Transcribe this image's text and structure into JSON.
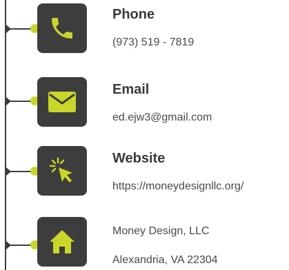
{
  "accent_color": "#c9d62a",
  "dark_color": "#3d3d3d",
  "contacts": [
    {
      "icon": "phone-icon",
      "title": "Phone",
      "detail": "(973) 519 - 7819"
    },
    {
      "icon": "envelope-icon",
      "title": "Email",
      "detail": "ed.ejw3@gmail.com"
    },
    {
      "icon": "cursor-click-icon",
      "title": "Website",
      "detail": "https://moneydesignllc.org/"
    },
    {
      "icon": "home-icon",
      "lines": [
        "Money Design, LLC",
        "Alexandria, VA 22304"
      ]
    }
  ]
}
